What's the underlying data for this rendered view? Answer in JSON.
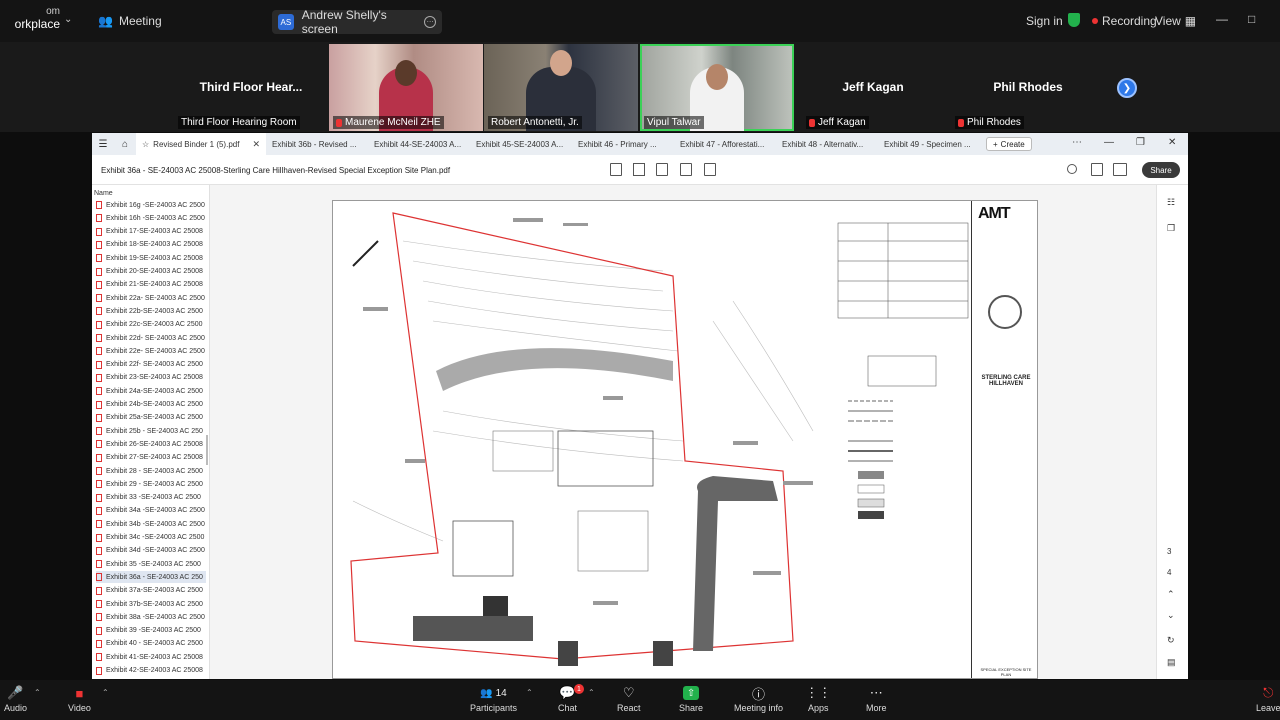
{
  "topbar": {
    "brand_line1": "om",
    "brand_line2": "orkplace",
    "meeting_label": "Meeting",
    "screen_avatar": "AS",
    "screen_label": "Andrew Shelly's screen",
    "signin_label": "Sign in",
    "recording_label": "Recording",
    "view_label": "View"
  },
  "gallery": {
    "tiles": [
      {
        "big": "Third Floor Hear...",
        "name": "Third Floor Hearing Room"
      },
      {
        "name": "Maurene McNeil ZHE"
      },
      {
        "name": "Robert Antonetti, Jr."
      },
      {
        "name": "Vipul Talwar"
      },
      {
        "big": "Jeff Kagan",
        "name": "Jeff Kagan"
      },
      {
        "big": "Phil Rhodes",
        "name": "Phil Rhodes"
      }
    ]
  },
  "pdf": {
    "tabs": [
      "Revised Binder 1 (5).pdf",
      "Exhibit 36b - Revised ...",
      "Exhibit 44-SE-24003 A...",
      "Exhibit 45-SE-24003 A...",
      "Exhibit 46 - Primary ...",
      "Exhibit 47 - Afforestati...",
      "Exhibit 48 - Alternativ...",
      "Exhibit 49 - Specimen ..."
    ],
    "create_label": "Create",
    "filename": "Exhibit 36a - SE-24003 AC 25008-Sterling Care Hillhaven-Revised Special Exception Site Plan.pdf",
    "share_label": "Share",
    "sidebar_header": "Name",
    "files": [
      "Exhibit 16g -SE-24003 AC 2500",
      "Exhibit 16h -SE-24003 AC 2500",
      "Exhibit 17-SE-24003 AC 25008",
      "Exhibit 18-SE-24003 AC 25008",
      "Exhibit 19-SE-24003 AC 25008",
      "Exhibit 20-SE-24003 AC 25008",
      "Exhibit 21-SE-24003 AC 25008",
      "Exhibit 22a- SE-24003 AC 2500",
      "Exhibit 22b-SE-24003 AC 2500",
      "Exhibit 22c-SE-24003 AC 2500",
      "Exhibit 22d- SE-24003 AC 2500",
      "Exhibit 22e- SE-24003 AC 2500",
      "Exhibit 22f- SE-24003 AC 2500",
      "Exhibit 23-SE-24003 AC 25008",
      "Exhibit 24a-SE-24003 AC 2500",
      "Exhibit 24b-SE-24003 AC 2500",
      "Exhibit 25a-SE-24003 AC 2500",
      "Exhibit 25b - SE-24003 AC 250",
      "Exhibit 26-SE-24003 AC 25008",
      "Exhibit 27-SE-24003 AC 25008",
      "Exhibit 28 - SE-24003 AC 2500",
      "Exhibit 29 - SE-24003 AC 2500",
      "Exhibit 33 -SE-24003 AC 2500",
      "Exhibit 34a -SE-24003 AC 2500",
      "Exhibit 34b -SE-24003 AC 2500",
      "Exhibit 34c -SE-24003 AC 2500",
      "Exhibit 34d -SE-24003 AC 2500",
      "Exhibit 35 -SE-24003 AC 2500",
      "Exhibit 36a - SE-24003 AC 250",
      "Exhibit 37a-SE-24003 AC 2500",
      "Exhibit 37b-SE-24003 AC 2500",
      "Exhibit 38a -SE-24003 AC 2500",
      "Exhibit 39 -SE-24003 AC 2500",
      "Exhibit 40 - SE-24003 AC 2500",
      "Exhibit 41-SE-24003 AC 25008",
      "Exhibit 42-SE-24003 AC 25008"
    ],
    "selected_index": 28,
    "page_numbers": [
      "3",
      "4"
    ],
    "title_block": {
      "logo": "AMT",
      "project": "STERLING CARE HILLHAVEN",
      "sheet": "SPECIAL EXCEPTION SITE PLAN"
    }
  },
  "controls": {
    "audio": "Audio",
    "video": "Video",
    "participants": "Participants",
    "participants_count": "14",
    "chat": "Chat",
    "chat_badge": "1",
    "react": "React",
    "share": "Share",
    "meeting_info": "Meeting info",
    "apps": "Apps",
    "more": "More",
    "leave": "Leave"
  }
}
